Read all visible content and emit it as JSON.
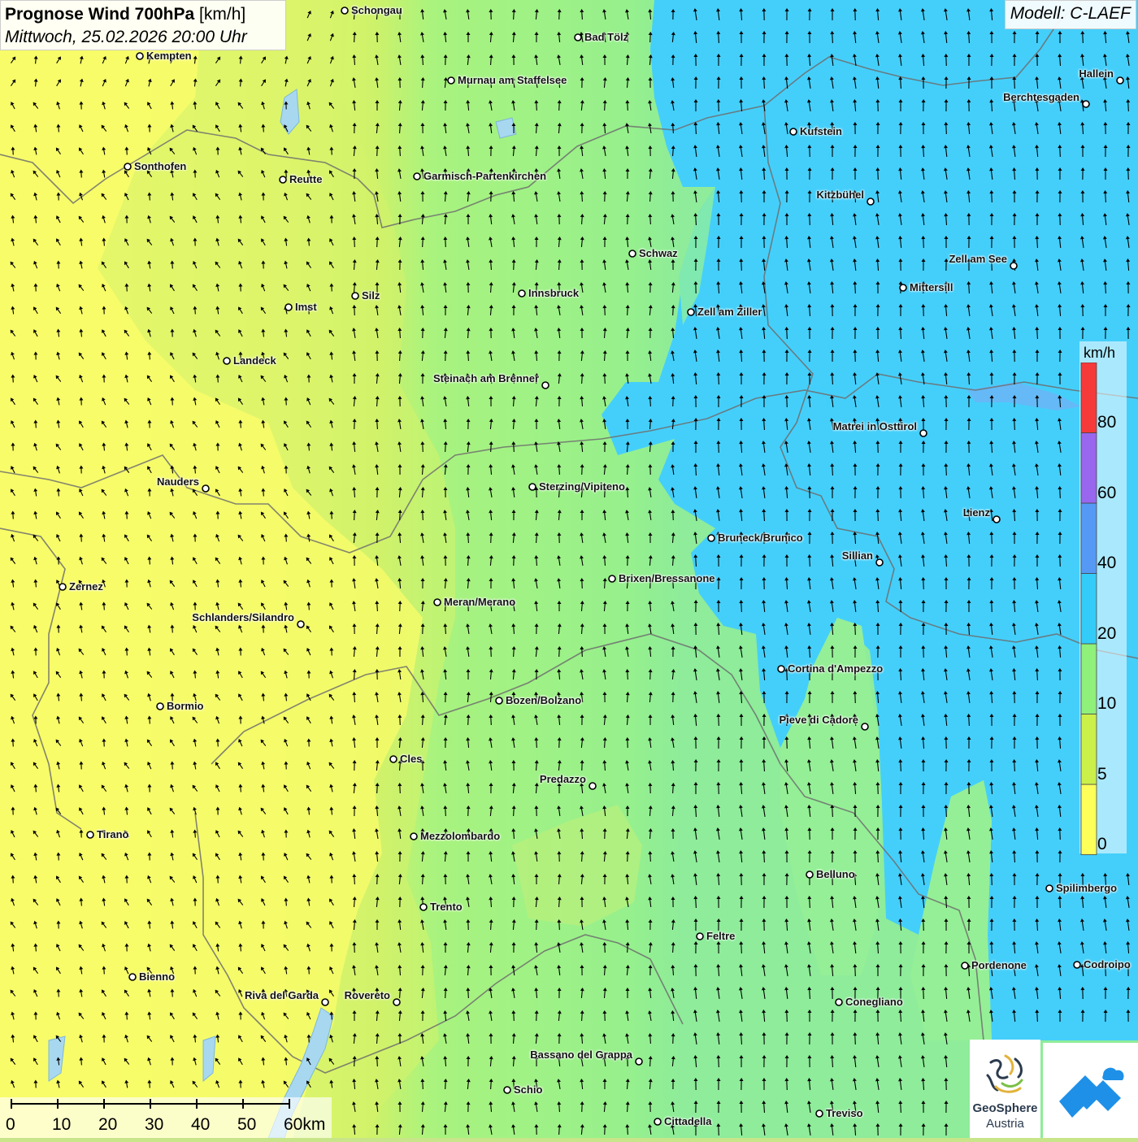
{
  "header": {
    "title_bold": "Prognose Wind 700hPa",
    "title_unit": "[km/h]",
    "subtitle": "Mittwoch, 25.02.2026 20:00 Uhr"
  },
  "model_label": "Modell: C-LAEF",
  "legend": {
    "unit": "km/h",
    "classes": [
      {
        "min": 0,
        "max": 5,
        "color": "#ffff5a"
      },
      {
        "min": 5,
        "max": 10,
        "color": "#cbf04a"
      },
      {
        "min": 10,
        "max": 20,
        "color": "#8ff07a"
      },
      {
        "min": 20,
        "max": 40,
        "color": "#33ccf8"
      },
      {
        "min": 40,
        "max": 60,
        "color": "#5599f5"
      },
      {
        "min": 60,
        "max": 80,
        "color": "#9966ee"
      },
      {
        "min": 80,
        "max": null,
        "color": "#f63a3a"
      }
    ],
    "labels": [
      "0",
      "5",
      "10",
      "20",
      "40",
      "60",
      "80"
    ]
  },
  "scalebar": {
    "labels": [
      "0",
      "10",
      "20",
      "30",
      "40",
      "50",
      "60km"
    ]
  },
  "logos": {
    "geosphere_line1": "GeoSphere",
    "geosphere_line2": "Austria"
  },
  "cities": [
    {
      "name": "Schongau",
      "label_side": "right"
    },
    {
      "name": "Kempten",
      "label_side": "right"
    },
    {
      "name": "Bad Tölz",
      "label_side": "right"
    },
    {
      "name": "Murnau am Staffelsee",
      "label_side": "right"
    },
    {
      "name": "Hallein",
      "label_side": "left"
    },
    {
      "name": "Berchtesgaden",
      "label_side": "left"
    },
    {
      "name": "Kufstein",
      "label_side": "right"
    },
    {
      "name": "Sonthofen",
      "label_side": "right"
    },
    {
      "name": "Reutte",
      "label_side": "right"
    },
    {
      "name": "Garmisch-Partenkirchen",
      "label_side": "right"
    },
    {
      "name": "Kitzbühel",
      "label_side": "left"
    },
    {
      "name": "Schwaz",
      "label_side": "right"
    },
    {
      "name": "Zell am See",
      "label_side": "left"
    },
    {
      "name": "Mittersill",
      "label_side": "right"
    },
    {
      "name": "Innsbruck",
      "label_side": "right"
    },
    {
      "name": "Imst",
      "label_side": "right"
    },
    {
      "name": "Silz",
      "label_side": "right"
    },
    {
      "name": "Zell am Ziller",
      "label_side": "right"
    },
    {
      "name": "Landeck",
      "label_side": "right"
    },
    {
      "name": "Steinach am Brenner",
      "label_side": "left"
    },
    {
      "name": "Matrei in Osttirol",
      "label_side": "left"
    },
    {
      "name": "Nauders",
      "label_side": "left"
    },
    {
      "name": "Sterzing/Vipiteno",
      "label_side": "right"
    },
    {
      "name": "Lienz",
      "label_side": "left"
    },
    {
      "name": "Bruneck/Brunico",
      "label_side": "right"
    },
    {
      "name": "Sillian",
      "label_side": "left"
    },
    {
      "name": "Zernez",
      "label_side": "right"
    },
    {
      "name": "Brixen/Bressanone",
      "label_side": "right"
    },
    {
      "name": "Meran/Merano",
      "label_side": "right"
    },
    {
      "name": "Schlanders/Silandro",
      "label_side": "left"
    },
    {
      "name": "Cortina d'Ampezzo",
      "label_side": "right"
    },
    {
      "name": "Bozen/Bolzano",
      "label_side": "right"
    },
    {
      "name": "Bormio",
      "label_side": "right"
    },
    {
      "name": "Pieve di Cadore",
      "label_side": "left"
    },
    {
      "name": "Cles",
      "label_side": "right"
    },
    {
      "name": "Predazzo",
      "label_side": "left"
    },
    {
      "name": "Tirano",
      "label_side": "right"
    },
    {
      "name": "Mezzolombardo",
      "label_side": "right"
    },
    {
      "name": "Belluno",
      "label_side": "right"
    },
    {
      "name": "Spilimbergo",
      "label_side": "right"
    },
    {
      "name": "Trento",
      "label_side": "right"
    },
    {
      "name": "Feltre",
      "label_side": "right"
    },
    {
      "name": "Pordenone",
      "label_side": "right"
    },
    {
      "name": "Codroipo",
      "label_side": "right"
    },
    {
      "name": "Bienno",
      "label_side": "right"
    },
    {
      "name": "Riva del Garda",
      "label_side": "left"
    },
    {
      "name": "Rovereto",
      "label_side": "left"
    },
    {
      "name": "Conegliano",
      "label_side": "right"
    },
    {
      "name": "Bassano del Grappa",
      "label_side": "left"
    },
    {
      "name": "Schio",
      "label_side": "right"
    },
    {
      "name": "Treviso",
      "label_side": "right"
    },
    {
      "name": "Cittadella",
      "label_side": "right"
    }
  ]
}
